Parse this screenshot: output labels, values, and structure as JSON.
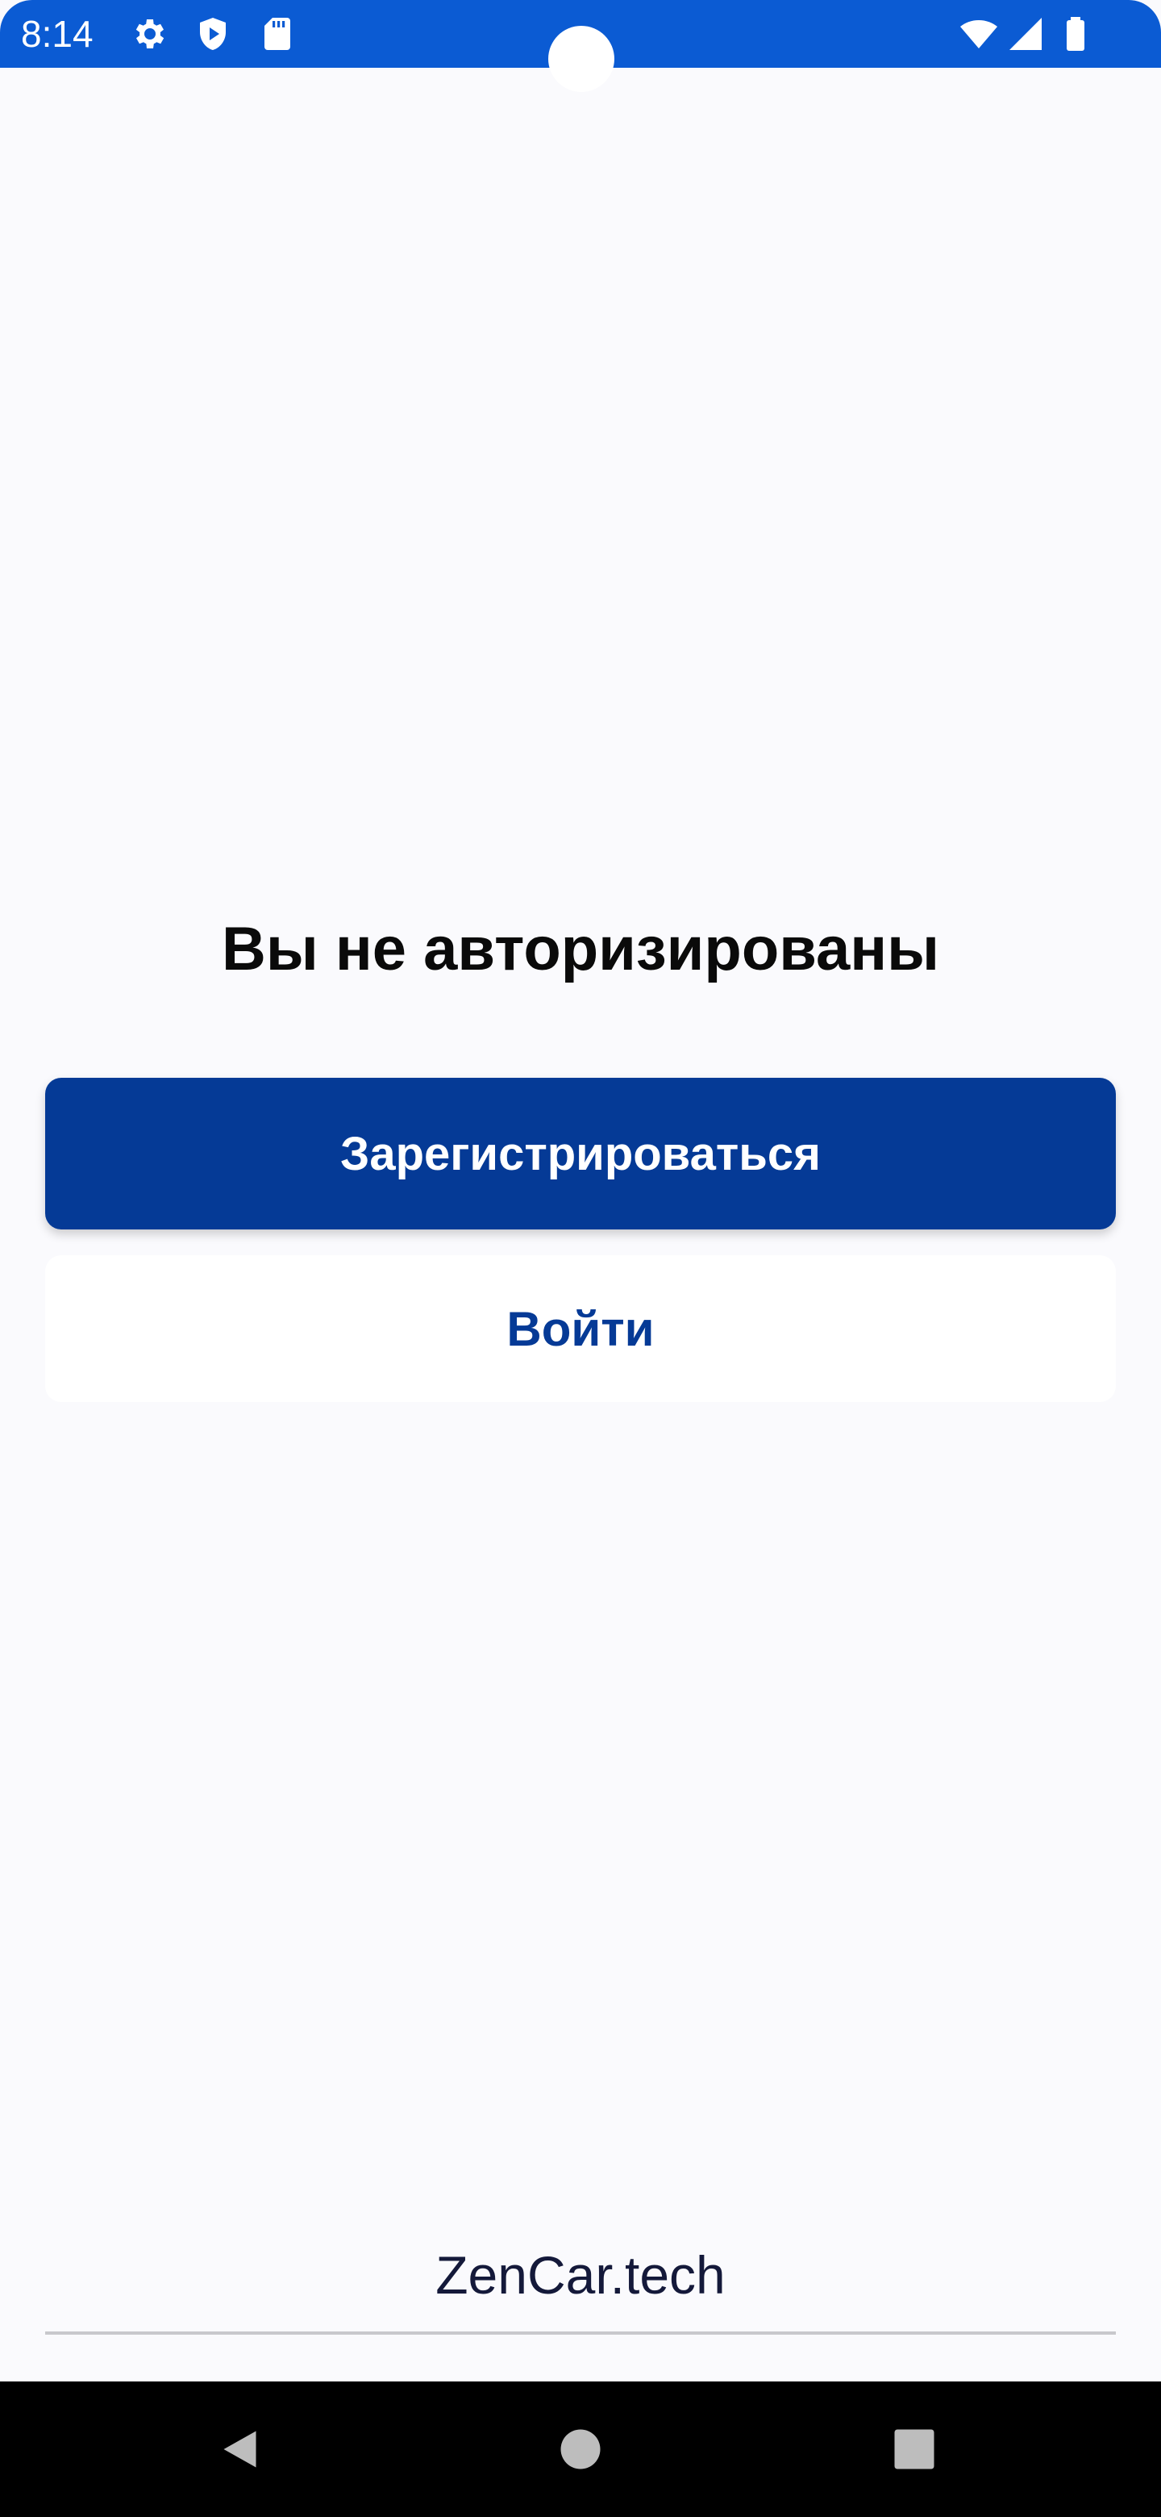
{
  "status_bar": {
    "time": "8:14",
    "background_color": "#0b5bd3",
    "icons": [
      "settings-icon",
      "shield-icon",
      "sd-card-icon",
      "wifi-icon",
      "signal-icon",
      "battery-icon"
    ]
  },
  "main": {
    "title": "Вы не авторизированы",
    "register_label": "Зарегистрироваться",
    "login_label": "Войти"
  },
  "footer": {
    "brand": "ZenCar.tech"
  },
  "nav_bar": {
    "icons": [
      "back-icon",
      "home-icon",
      "recents-icon"
    ]
  },
  "colors": {
    "accent": "#053a96",
    "background": "#fafafd"
  }
}
